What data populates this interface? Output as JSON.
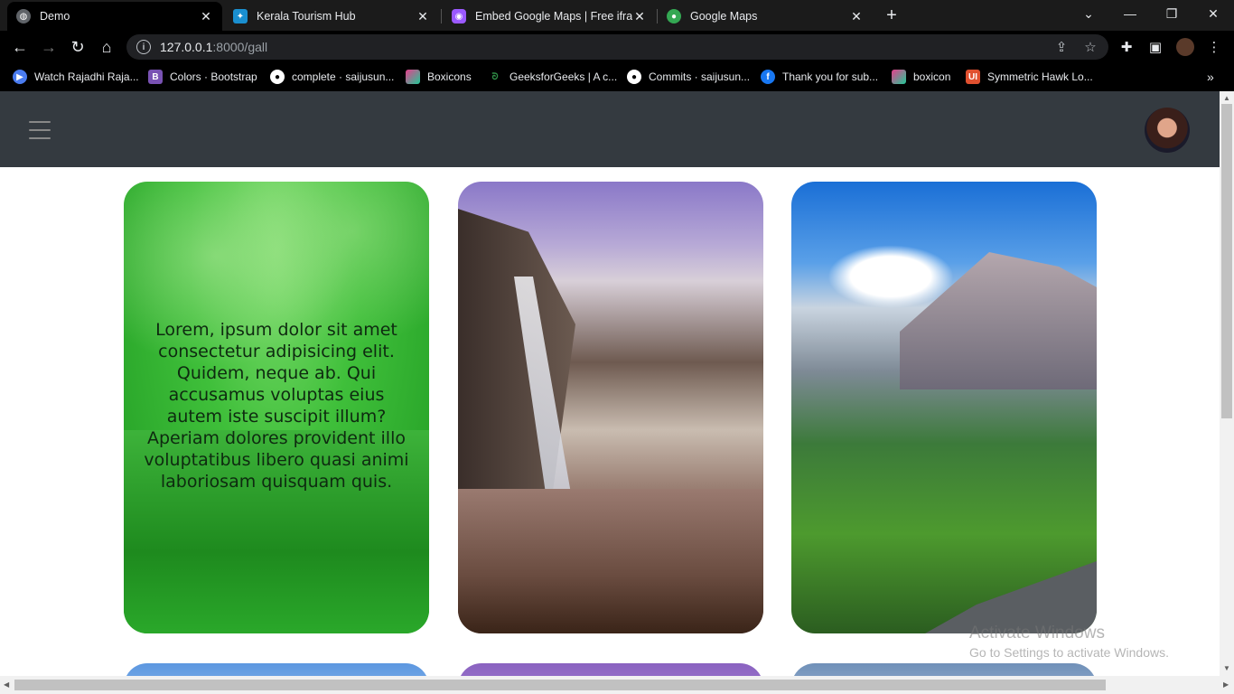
{
  "browser": {
    "tabs": [
      {
        "title": "Demo",
        "icon": "globe-icon",
        "active": true
      },
      {
        "title": "Kerala Tourism Hub",
        "icon": "bird-icon",
        "active": false
      },
      {
        "title": "Embed Google Maps | Free ifram",
        "icon": "embed-icon",
        "active": false
      },
      {
        "title": "Google Maps",
        "icon": "maps-pin-icon",
        "active": false
      }
    ],
    "url_host": "127.0.0.1",
    "url_rest": ":8000/gall",
    "bookmarks": [
      {
        "label": "Watch Rajadhi Raja...",
        "icon": "play-icon",
        "color": "#4a7cf0"
      },
      {
        "label": "Colors · Bootstrap",
        "icon": "bootstrap-icon",
        "color": "#7952b3"
      },
      {
        "label": "complete · saijusun...",
        "icon": "github-icon",
        "color": "#333333"
      },
      {
        "label": "Boxicons",
        "icon": "boxicons-icon",
        "color": "#e83e8c"
      },
      {
        "label": "GeeksforGeeks | A c...",
        "icon": "gfg-icon",
        "color": "#2f8d46"
      },
      {
        "label": "Commits · saijusun...",
        "icon": "github-icon",
        "color": "#333333"
      },
      {
        "label": "Thank you for sub...",
        "icon": "facebook-icon",
        "color": "#1877f2"
      },
      {
        "label": "boxicon",
        "icon": "boxicons-icon",
        "color": "#e83e8c"
      },
      {
        "label": "Symmetric Hawk Lo...",
        "icon": "ui-icon",
        "color": "#e0502f"
      }
    ]
  },
  "gallery": {
    "card1_text": "Lorem, ipsum dolor sit amet consectetur adipisicing elit. Quidem, neque ab. Qui accusamus voluptas eius autem iste suscipit illum? Aperiam dolores provident illo voluptatibus libero quasi animi laboriosam quisquam quis."
  },
  "watermark": {
    "line1": "Activate Windows",
    "line2": "Go to Settings to activate Windows."
  }
}
